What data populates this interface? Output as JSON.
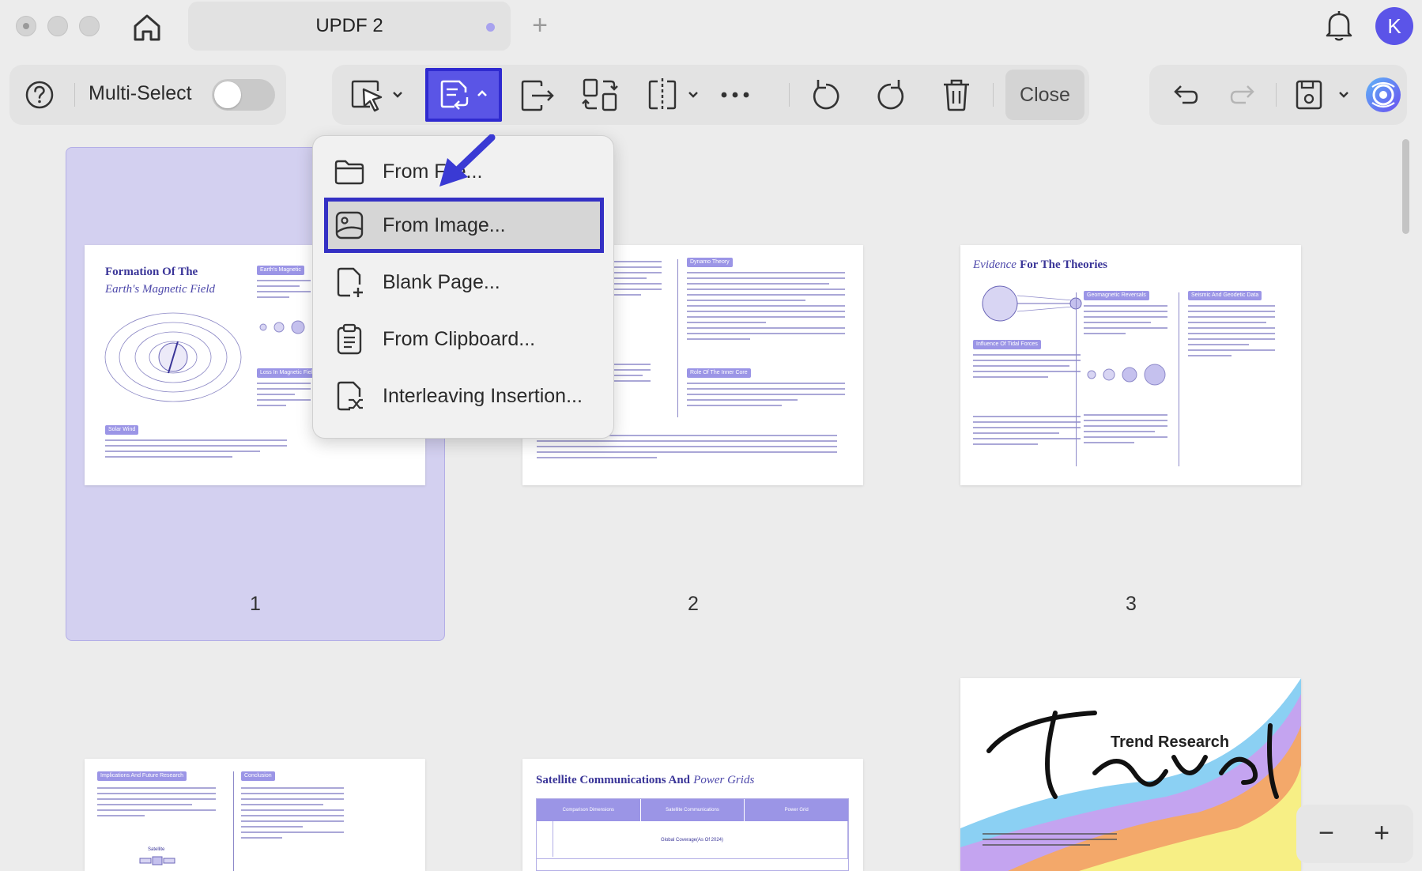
{
  "titlebar": {
    "tab_title": "UPDF 2",
    "new_tab": "+",
    "avatar_letter": "K"
  },
  "toolbar": {
    "multi_select_label": "Multi-Select",
    "multi_select_on": false,
    "close_label": "Close"
  },
  "menu": {
    "items": [
      {
        "label": "From File...",
        "icon": "folder-icon"
      },
      {
        "label": "From Image...",
        "icon": "image-icon",
        "highlighted": true
      },
      {
        "label": "Blank Page...",
        "icon": "blank-page-icon"
      },
      {
        "label": "From Clipboard...",
        "icon": "clipboard-icon"
      },
      {
        "label": "Interleaving Insertion...",
        "icon": "interleave-icon"
      }
    ]
  },
  "pages": [
    {
      "number": "1",
      "title": "Formation Of The",
      "subtitle": "Earth's Magnetic Field",
      "pills": [
        "Earth's Magnetic",
        "Loss In Magnetic Field",
        "Solar Wind"
      ]
    },
    {
      "number": "2",
      "pills": [
        "Dynamo Theory",
        "Role Of The Inner Core"
      ]
    },
    {
      "number": "3",
      "title_italic": "Evidence",
      "title_bold": "For The Theories",
      "pills": [
        "Geomagnetic Reversals",
        "Seismic And Geodetic Data",
        "Influence Of Tidal Forces"
      ]
    },
    {
      "pills": [
        "Implications And Future Research",
        "Conclusion"
      ],
      "label": "Satellite"
    },
    {
      "title_bold": "Satellite Communications And",
      "title_italic": "Power Grids",
      "table_headers": [
        "Comparison Dimensions",
        "Satellite Communications",
        "Power Grid"
      ],
      "table_row": "Global Coverage(As Of 2024)"
    },
    {
      "heading": "Trend Research",
      "script": "Travel"
    }
  ],
  "zoom": {
    "minus": "−",
    "plus": "+"
  },
  "colors": {
    "accent": "#5a55e6",
    "selection": "#d3d0f0",
    "avatar": "#5b54e8"
  }
}
